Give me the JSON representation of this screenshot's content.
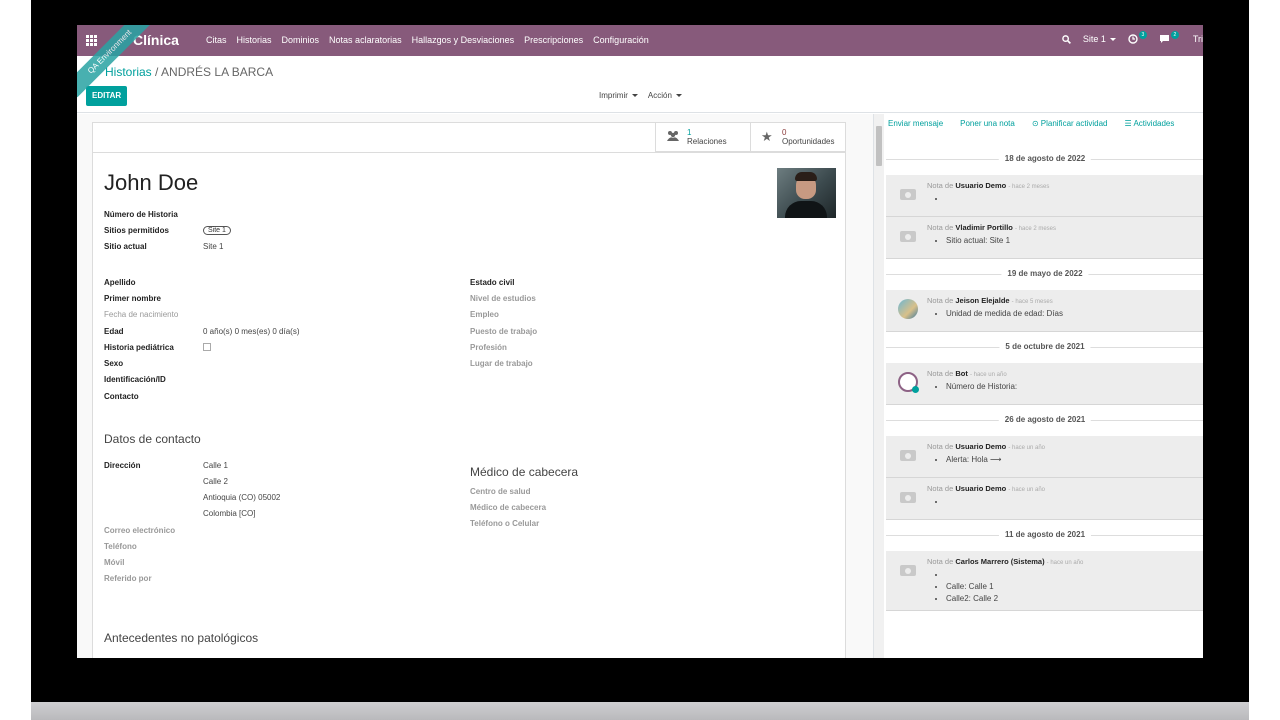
{
  "navbar": {
    "brand": "Clínica",
    "menu": [
      "Citas",
      "Historias",
      "Dominios",
      "Notas aclaratorias",
      "Hallazgos y Desviaciones",
      "Prescripciones",
      "Configuración"
    ],
    "site_selector": "Site 1",
    "activities_count": "3",
    "messages_count": "2",
    "user": "Tri"
  },
  "ribbon": "QA Environment",
  "control": {
    "breadcrumb_parent": "Historias",
    "breadcrumb_sep": "/",
    "breadcrumb_current": "ANDRÉS LA BARCA",
    "edit_label": "EDITAR",
    "print_label": "Imprimir",
    "action_label": "Acción"
  },
  "stat_buttons": {
    "relations_count": "1",
    "relations_label": "Relaciones",
    "opportunities_count": "0",
    "opportunities_label": "Oportunidades"
  },
  "form": {
    "name": "John Doe",
    "header_fields": [
      {
        "label": "Número de Historia",
        "value": ""
      },
      {
        "label": "Sitios permitidos",
        "value": "Site 1"
      },
      {
        "label": "Sitio actual",
        "value": "Site 1"
      }
    ],
    "left_fields": [
      {
        "label": "Apellido",
        "value": ""
      },
      {
        "label": "Primer nombre",
        "value": ""
      },
      {
        "label": "Fecha de nacimiento",
        "value": ""
      },
      {
        "label": "Edad",
        "value": "0 año(s) 0 mes(es) 0 día(s)"
      },
      {
        "label": "Historia pediátrica",
        "value": ""
      },
      {
        "label": "Sexo",
        "value": ""
      },
      {
        "label": "Identificación/ID",
        "value": ""
      },
      {
        "label": "Contacto",
        "value": ""
      }
    ],
    "right_fields": [
      "Estado civil",
      "Nivel de estudios",
      "Empleo",
      "Puesto de trabajo",
      "Profesión",
      "Lugar de trabajo"
    ],
    "contact_section": "Datos de contacto",
    "address_label": "Dirección",
    "address_lines": [
      "Calle 1",
      "Calle 2",
      "Antioquia (CO)  05002",
      "Colombia [CO]"
    ],
    "contact_fields": [
      "Correo electrónico",
      "Teléfono",
      "Móvil",
      "Referido por"
    ],
    "doctor_section": "Médico de cabecera",
    "doctor_fields": [
      "Centro de salud",
      "Médico de cabecera",
      "Teléfono o Celular"
    ],
    "antecedents_section": "Antecedentes no patológicos"
  },
  "chatter": {
    "send_message": "Enviar mensaje",
    "log_note": "Poner una nota",
    "schedule": "Planificar actividad",
    "activities": "Actividades",
    "groups": [
      {
        "date": "18 de agosto de 2022",
        "messages": [
          {
            "prefix": "Nota de",
            "author": "Usuario Demo",
            "time": "- hace 2 meses",
            "lines": [
              ""
            ]
          },
          {
            "prefix": "Nota de",
            "author": "Vladimir Portillo",
            "time": "- hace 2 meses",
            "lines": [
              "Sitio actual: Site 1"
            ]
          }
        ]
      },
      {
        "date": "19 de mayo de 2022",
        "messages": [
          {
            "prefix": "Nota de",
            "author": "Jeison Elejalde",
            "time": "- hace 5 meses",
            "lines": [
              "Unidad de medida de edad: Días"
            ]
          }
        ]
      },
      {
        "date": "5 de octubre de 2021",
        "messages": [
          {
            "prefix": "Nota de",
            "author": "Bot",
            "time": "- hace un año",
            "lines": [
              "Número de Historia: "
            ]
          }
        ]
      },
      {
        "date": "26 de agosto de 2021",
        "messages": [
          {
            "prefix": "Nota de",
            "author": "Usuario Demo",
            "time": "- hace un año",
            "lines": [
              "Alerta: Hola ⟶"
            ]
          },
          {
            "prefix": "Nota de",
            "author": "Usuario Demo",
            "time": "- hace un año",
            "lines": [
              ""
            ]
          }
        ]
      },
      {
        "date": "11 de agosto de 2021",
        "messages": [
          {
            "prefix": "Nota de",
            "author": "Carlos Marrero (Sistema)",
            "time": "- hace un año",
            "lines": [
              "",
              "Calle: Calle 1",
              "Calle2: Calle 2"
            ]
          }
        ]
      }
    ]
  },
  "colors": {
    "brand": "#875a7b",
    "accent": "#00a09d"
  }
}
